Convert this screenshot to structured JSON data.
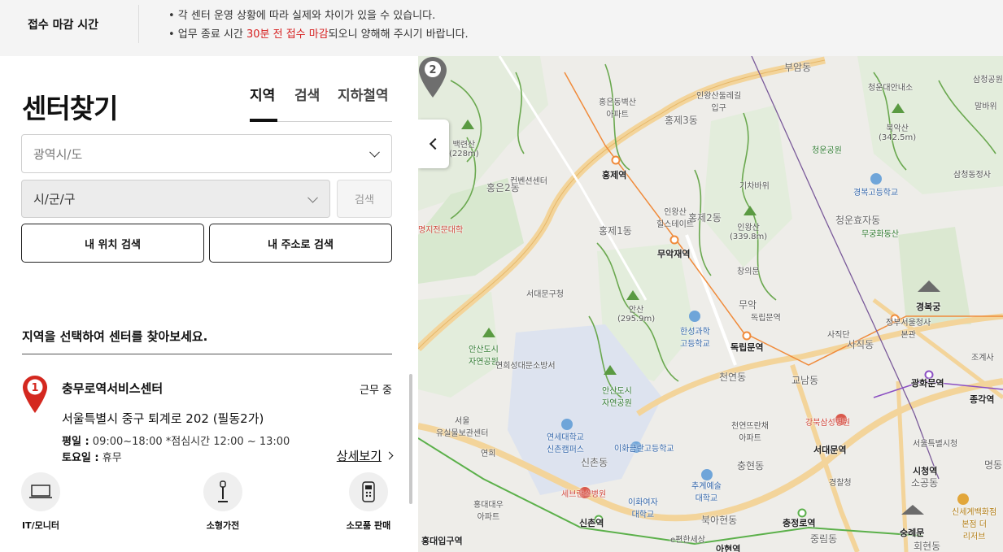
{
  "notice": {
    "title": "접수 마감 시간",
    "line1": "• 각 센터 운영 상황에 따라 실제와 차이가 있을 수 있습니다.",
    "line2_pre": "• 업무 종료 시간 ",
    "line2_hl": "30분 전 접수 마감",
    "line2_post": "되오니 양해해 주시기 바랍니다."
  },
  "page": {
    "title": "센터찾기",
    "tabs": [
      "지역",
      "검색",
      "지하철역"
    ],
    "active_tab": "지역"
  },
  "filters": {
    "province_placeholder": "광역시/도",
    "city_placeholder": "시/군/구",
    "search_label": "검색",
    "my_location_label": "내 위치 검색",
    "my_address_label": "내 주소로 검색"
  },
  "guide": "지역을 선택하여 센터를 찾아보세요.",
  "centers": [
    {
      "number": "1",
      "name": "충무로역서비스센터",
      "status": "근무 중",
      "address": "서울특별시 중구 퇴계로 202 (필동2가)",
      "weekday_label": "평일 :",
      "weekday_hours": "09:00~18:00 *점심시간 12:00 ~ 13:00",
      "saturday_label": "토요일 :",
      "saturday_hours": "휴무",
      "detail_label": "상세보기",
      "categories": [
        {
          "label": "IT/모니터",
          "icon": "monitor-icon"
        },
        {
          "label": "소형가전",
          "icon": "small-appliance-icon"
        },
        {
          "label": "소모품 판매",
          "icon": "consumables-icon"
        }
      ]
    }
  ],
  "map": {
    "pin2_number": "2",
    "labels": {
      "buam": "부암동",
      "samcheong": "삼청공원",
      "cheongwadae": "청운대안내소",
      "malbawi": "말바위",
      "hongeun_apt": "홍은동벽산\n아파트",
      "inwang_tunnel": "인왕산둘레길\n입구",
      "hongje3": "홍제3동",
      "bugak": "북악산\n(342.5m)",
      "baekryeon": "백련산\n(228m)",
      "hongjestn": "홍제역",
      "convention": "컨벤션센터",
      "hongeun2": "홍은2동",
      "cheongun_park": "청운공원",
      "samcheongdong": "삼청동정사",
      "gichibawi": "기차바위",
      "gyeongbok_hs": "경복고등학교",
      "inwang_hills": "인왕산\n힐스테이트",
      "hongje2": "홍제2동",
      "inwangsan": "인왕산\n(339.8m)",
      "cheongunhyoja": "청운효자동",
      "mugunghwa": "무궁화동산",
      "hongje1": "홍제1동",
      "muakjae": "무악재역",
      "changuimun": "창의문",
      "myongji": "명지전문대학",
      "seodaemun_office": "서대문구청",
      "muak": "무악",
      "dokripmun_park": "독립문역",
      "gyeongbokgung": "경복궁",
      "ansan": "안산\n(295.9m)",
      "hansung": "한성과학\n고등학교",
      "sajik": "사직단",
      "sajikdong": "사직동",
      "jeongbu": "정부서울청사\n본관",
      "ansan_park": "안산도시\n자연공원",
      "yeonhui_fire": "연희성대문소방서",
      "dokripmun": "독립문역",
      "josegye": "조계사",
      "ansan_park2": "안산도시\n자연공원",
      "cheonyeon": "천연동",
      "gyonam": "교남동",
      "gwanghwamun": "광화문역",
      "jonggak": "종각역",
      "seodaemun_post": "서울\n유실물보관센터",
      "yonsei_apt": "천연뜨란채\n아파트",
      "kangbuk_hosp": "강북삼성병원",
      "seoul_city": "서울특별시청",
      "yonsei": "연세대학교\n신촌캠퍼스",
      "ewha_hs": "이화금란고등학교",
      "seodaemun_stn": "서대문역",
      "yeonhui": "연희",
      "sinchon_dong": "신촌동",
      "chunghyeon": "충현동",
      "cityhall": "시청역",
      "sogong": "소공동",
      "severance": "세브란스병원",
      "gyeongchal": "경찰청",
      "myeong": "명동",
      "hongdae_apt": "홍대대우\n아파트",
      "ewha_univ": "이화여자\n대학교",
      "art_univ": "추계예술\n대학교",
      "shinsegae": "신세계백화점\n본점 더\n리저브",
      "sinchon_stn": "신촌역",
      "bukahyeon": "북아현동",
      "chungjeongno": "충정로역",
      "sungnyemun": "숭례문",
      "hongik": "홍대입구역",
      "ehyeon": "e편한세상",
      "junglim": "중림동",
      "hoehyeon": "회현동",
      "ahyeon": "아현역"
    }
  }
}
